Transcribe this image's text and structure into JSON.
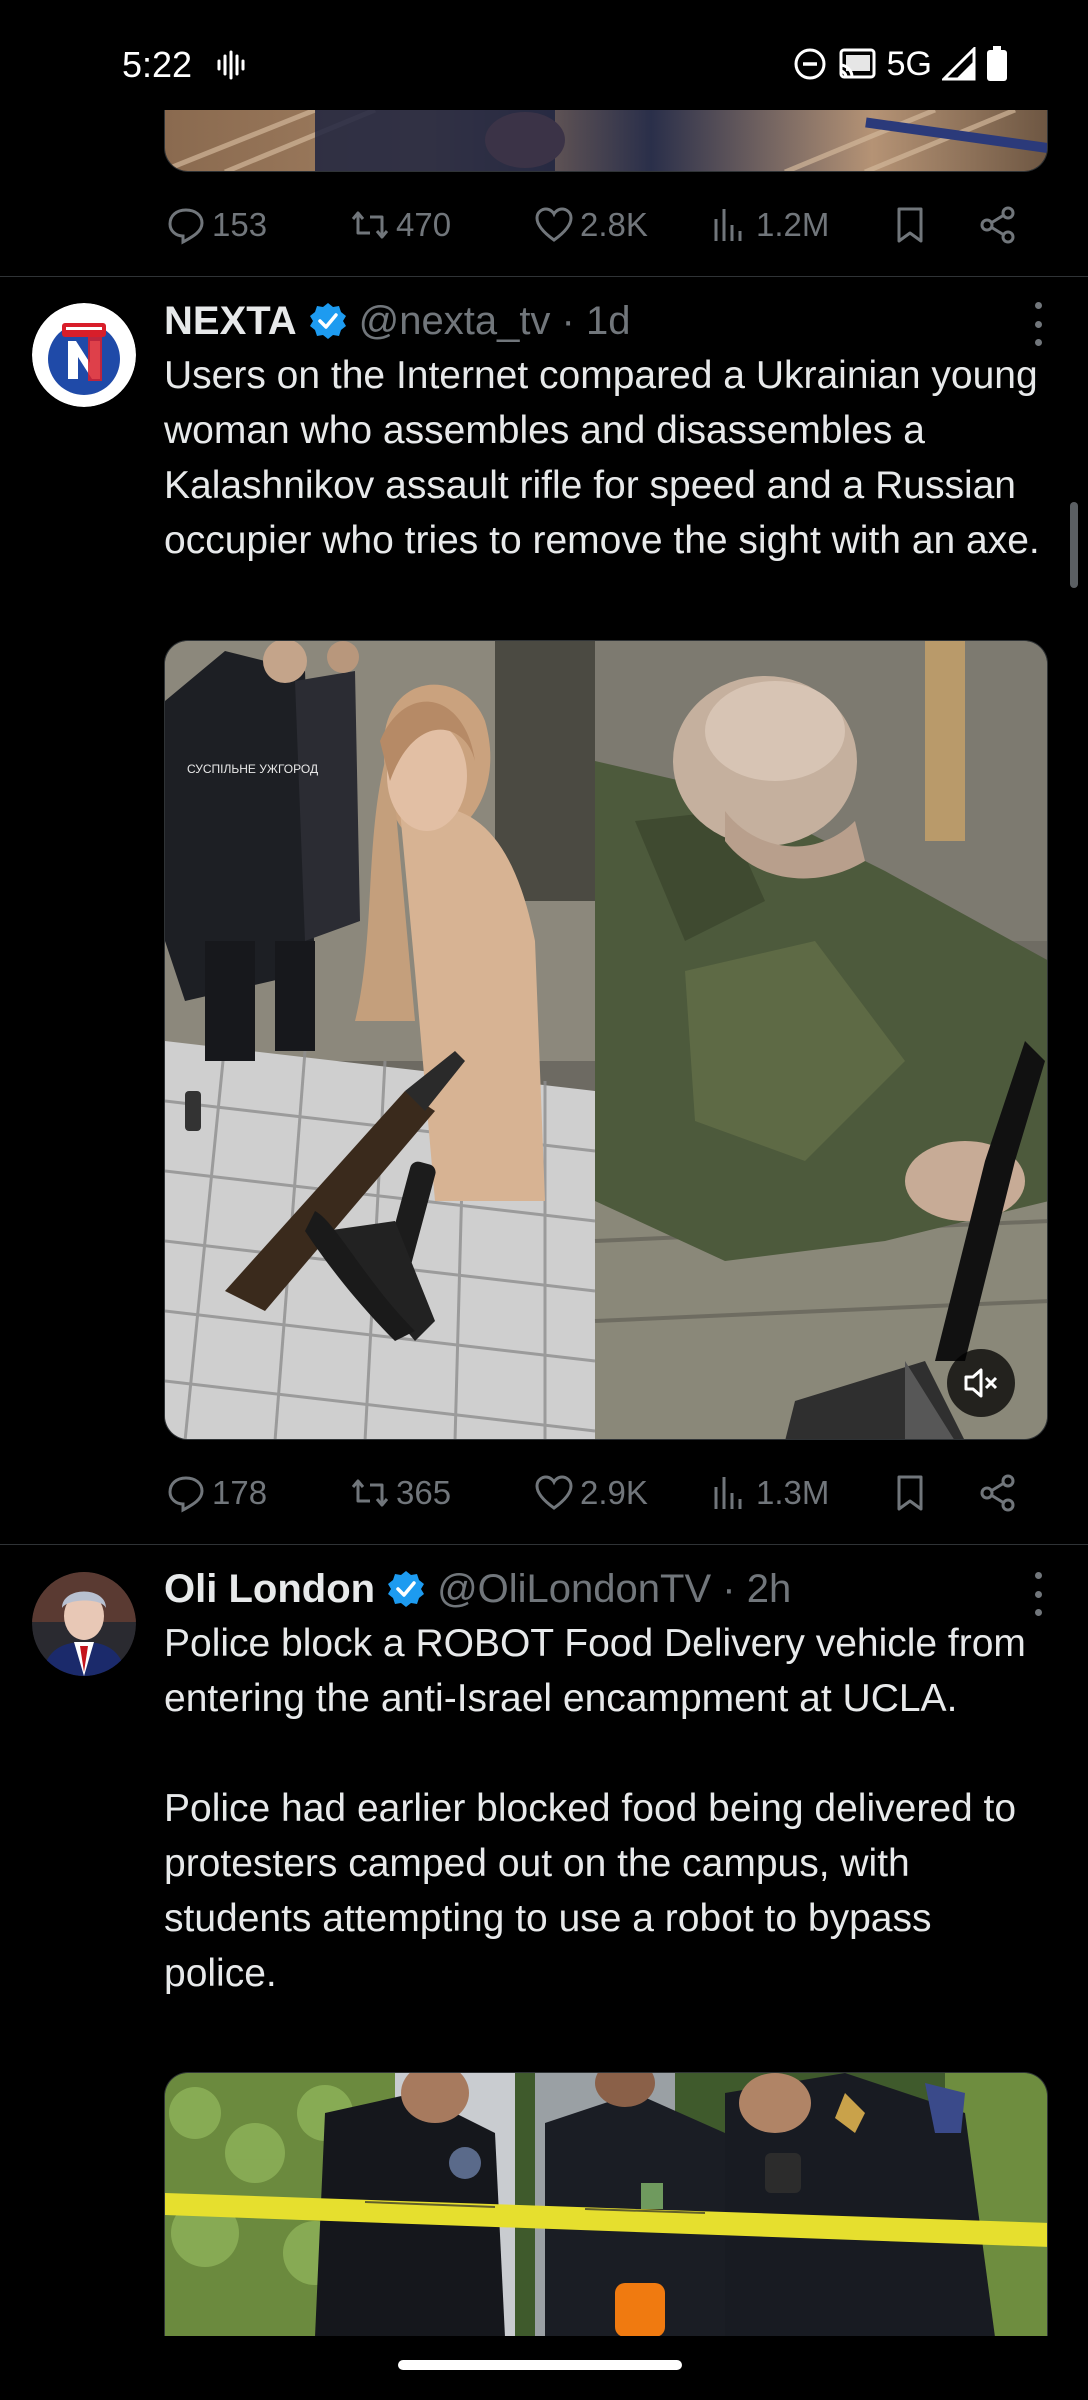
{
  "status_bar": {
    "time": "5:22",
    "network": "5G",
    "icons": [
      "sound-wave-icon",
      "do-not-disturb-icon",
      "cast-icon",
      "signal-icon",
      "battery-icon"
    ]
  },
  "top_tweet_actions": {
    "replies": "153",
    "retweets": "470",
    "likes": "2.8K",
    "views": "1.2M"
  },
  "tweets": [
    {
      "name": "NEXTA",
      "handle": "@nexta_tv · 1d",
      "text": "Users on the Internet compared a Ukrainian young woman who assembles and disassembles a Kalashnikov assault rifle for speed and a Russian occupier who tries to remove the sight with an axe.",
      "media_caption": "СУСПІЛЬНЕ УЖГОРОД",
      "replies": "178",
      "retweets": "365",
      "likes": "2.9K",
      "views": "1.3M"
    },
    {
      "name": "Oli London",
      "handle": "@OliLondonTV · 2h",
      "text": "Police block a ROBOT Food Delivery vehicle from entering the anti-Israel encampment at UCLA.\n\nPolice had earlier blocked food being delivered to protesters camped out on the campus, with students attempting to use a robot to bypass police."
    }
  ],
  "colors": {
    "background": "#000000",
    "text": "#e7e9ea",
    "muted": "#71767b",
    "verified": "#1d9bf0",
    "divider": "#2f3336",
    "nexta_red": "#d81e2a",
    "nexta_blue": "#1f4aa8"
  }
}
